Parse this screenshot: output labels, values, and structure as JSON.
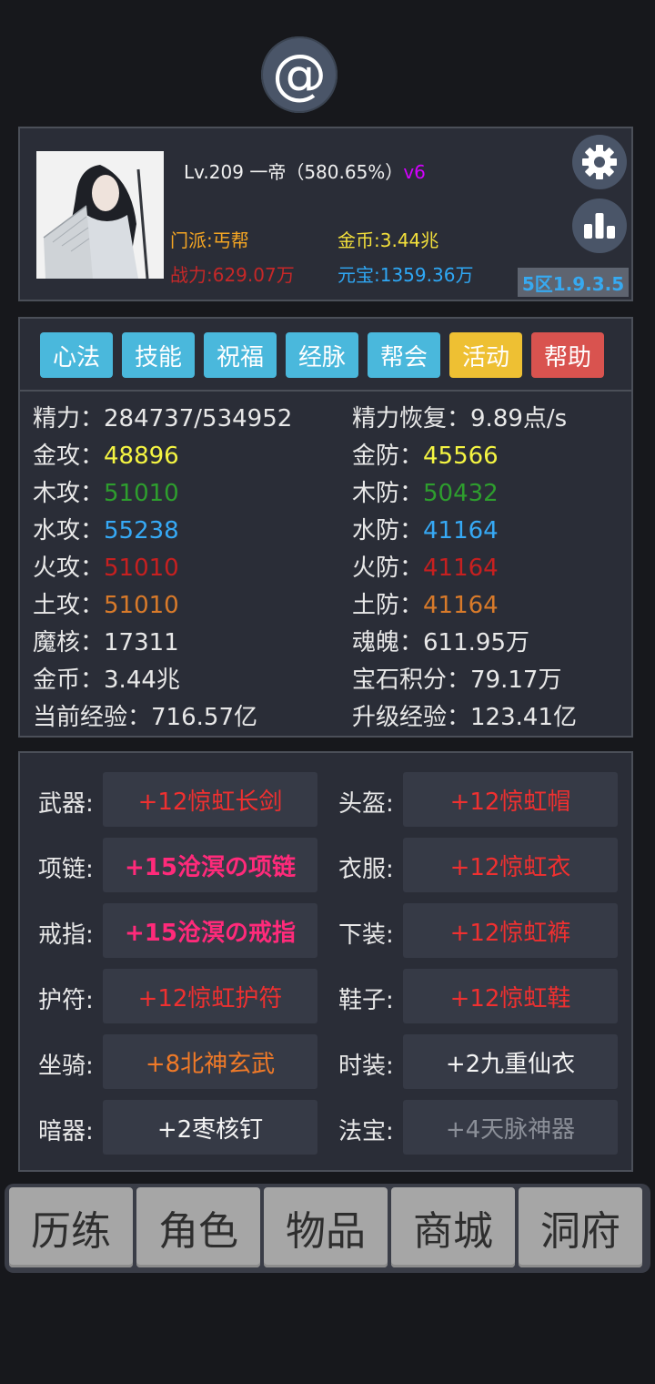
{
  "header": {
    "at_glyph": "@"
  },
  "profile": {
    "level_text": "Lv.209 一帝（580.65%）",
    "vip": "v6",
    "sect": "门派:丐帮",
    "power": "战力:629.07万",
    "gold": "金币:3.44兆",
    "yuanbao": "元宝:1359.36万",
    "version": "5区1.9.3.5",
    "colors": {
      "sect": "#f5a623",
      "power": "#c62828",
      "gold": "#f3e03b",
      "yuanbao": "#2fa8f5"
    }
  },
  "menu": [
    {
      "label": "心法",
      "color": "#4ab8dc"
    },
    {
      "label": "技能",
      "color": "#4ab8dc"
    },
    {
      "label": "祝福",
      "color": "#4ab8dc"
    },
    {
      "label": "经脉",
      "color": "#4ab8dc"
    },
    {
      "label": "帮会",
      "color": "#4ab8dc"
    },
    {
      "label": "活动",
      "color": "#eec033"
    },
    {
      "label": "帮助",
      "color": "#d9534f"
    }
  ],
  "stats": [
    {
      "label": "精力：",
      "value": "284737/534952",
      "color": "#e8e8e8"
    },
    {
      "label": "精力恢复：",
      "value": "9.89点/s",
      "color": "#e8e8e8"
    },
    {
      "label": "金攻：",
      "value": "48896",
      "color": "#f5f542"
    },
    {
      "label": "金防：",
      "value": "45566",
      "color": "#f5f542"
    },
    {
      "label": "木攻：",
      "value": "51010",
      "color": "#2e9e2e"
    },
    {
      "label": "木防：",
      "value": "50432",
      "color": "#2e9e2e"
    },
    {
      "label": "水攻：",
      "value": "55238",
      "color": "#36a9f5"
    },
    {
      "label": "水防：",
      "value": "41164",
      "color": "#36a9f5"
    },
    {
      "label": "火攻：",
      "value": "51010",
      "color": "#c62020"
    },
    {
      "label": "火防：",
      "value": "41164",
      "color": "#c62020"
    },
    {
      "label": "土攻：",
      "value": "51010",
      "color": "#d87a2a"
    },
    {
      "label": "土防：",
      "value": "41164",
      "color": "#d87a2a"
    },
    {
      "label": "魔核：",
      "value": "17311",
      "color": "#e8e8e8"
    },
    {
      "label": "魂魄：",
      "value": "611.95万",
      "color": "#e8e8e8"
    },
    {
      "label": "金币：",
      "value": "3.44兆",
      "color": "#e8e8e8"
    },
    {
      "label": "宝石积分：",
      "value": "79.17万",
      "color": "#e8e8e8"
    },
    {
      "label": "当前经验：",
      "value": "716.57亿",
      "color": "#e8e8e8"
    },
    {
      "label": "升级经验：",
      "value": "123.41亿",
      "color": "#e8e8e8"
    }
  ],
  "equipment": [
    {
      "slot": "武器:",
      "item": "+12惊虹长剑",
      "color": "#ef3030"
    },
    {
      "slot": "头盔:",
      "item": "+12惊虹帽",
      "color": "#ef3030"
    },
    {
      "slot": "项链:",
      "item": "+15沧溟の项链",
      "color": "#ff2a7a"
    },
    {
      "slot": "衣服:",
      "item": "+12惊虹衣",
      "color": "#ef3030"
    },
    {
      "slot": "戒指:",
      "item": "+15沧溟の戒指",
      "color": "#ff2a7a"
    },
    {
      "slot": "下装:",
      "item": "+12惊虹裤",
      "color": "#ef3030"
    },
    {
      "slot": "护符:",
      "item": "+12惊虹护符",
      "color": "#ef3030"
    },
    {
      "slot": "鞋子:",
      "item": "+12惊虹鞋",
      "color": "#ef3030"
    },
    {
      "slot": "坐骑:",
      "item": "+8北神玄武",
      "color": "#f07a28"
    },
    {
      "slot": "时装:",
      "item": "+2九重仙衣",
      "color": "#f4f4f4"
    },
    {
      "slot": "暗器:",
      "item": "+2枣核钉",
      "color": "#f4f4f4"
    },
    {
      "slot": "法宝:",
      "item": "+4天脉神器",
      "color": "#8b8f98"
    }
  ],
  "tabs": [
    "历练",
    "角色",
    "物品",
    "商城",
    "洞府"
  ]
}
